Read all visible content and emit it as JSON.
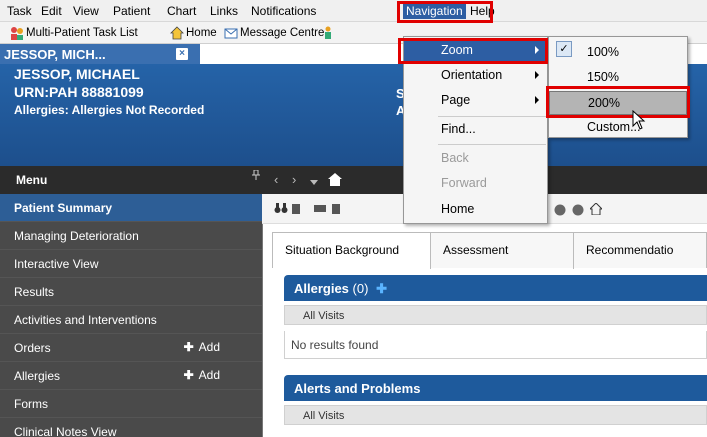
{
  "menubar": {
    "items": [
      "Task",
      "Edit",
      "View",
      "Patient",
      "Chart",
      "Links",
      "Notifications",
      "Navigation",
      "Help"
    ]
  },
  "toolbar": {
    "items": [
      "Multi-Patient Task List",
      "Home",
      "Message Centre"
    ]
  },
  "patient_tab": {
    "label": "JESSOP, MICH...",
    "close": "×"
  },
  "banner": {
    "name": "JESSOP, MICHAEL",
    "urn": "URN:PAH 88881099",
    "allergies": "Allergies: Allergies Not Recorded",
    "s_fragment": "S",
    "a_fragment": "A"
  },
  "sidebar": {
    "header": "Menu",
    "pin": "ᵖ",
    "items": [
      {
        "label": "Patient Summary",
        "selected": true
      },
      {
        "label": "Managing Deterioration"
      },
      {
        "label": "Interactive View"
      },
      {
        "label": "Results"
      },
      {
        "label": "Activities and Interventions"
      },
      {
        "label": "Orders",
        "add": "Add"
      },
      {
        "label": "Allergies",
        "add": "Add"
      },
      {
        "label": "Forms"
      },
      {
        "label": "Clinical Notes View"
      }
    ]
  },
  "content": {
    "tabs": [
      "Situation Background",
      "Assessment",
      "Recommendatio"
    ],
    "allergies_header": "Allergies",
    "allergies_count": "(0)",
    "allergies_sub": "All Visits",
    "no_results": "No results found",
    "alerts_header": "Alerts and Problems",
    "alerts_sub": "All Visits"
  },
  "navigation_menu": {
    "items": [
      {
        "label": "Zoom",
        "submenu": true,
        "highlighted": true
      },
      {
        "label": "Orientation",
        "submenu": true
      },
      {
        "label": "Page",
        "submenu": true
      },
      {
        "label": "Find..."
      },
      {
        "label": "Back",
        "disabled": true
      },
      {
        "label": "Forward",
        "disabled": true
      },
      {
        "label": "Home"
      }
    ]
  },
  "zoom_menu": {
    "items": [
      {
        "label": "100%",
        "checked": true
      },
      {
        "label": "150%"
      },
      {
        "label": "200%",
        "highlighted": true
      },
      {
        "label": "Custom..."
      }
    ],
    "check": "✓"
  },
  "colors": {
    "banner_blue": "#1d4f8c",
    "menu_highlight": "#2d5ea3",
    "annotation_red": "#e00000"
  }
}
